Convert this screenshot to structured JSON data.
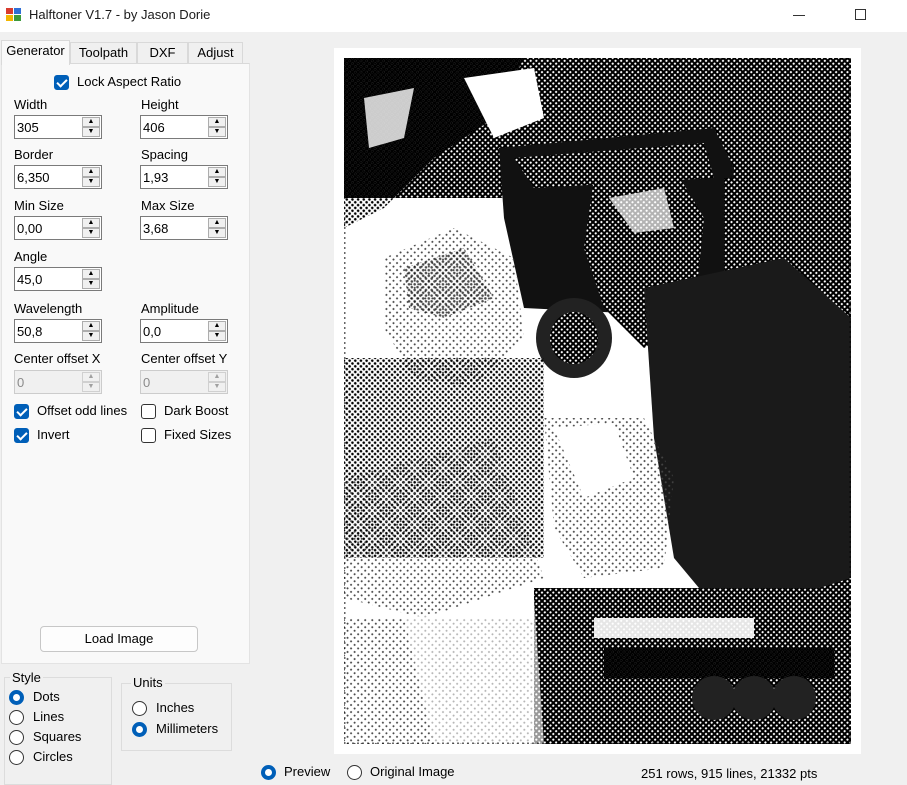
{
  "window": {
    "title": "Halftoner V1.7 - by Jason Dorie"
  },
  "tabs": [
    {
      "label": "Generator",
      "active": true
    },
    {
      "label": "Toolpath",
      "active": false
    },
    {
      "label": "DXF",
      "active": false
    },
    {
      "label": "Adjust",
      "active": false
    }
  ],
  "generator": {
    "lock_aspect": {
      "label": "Lock Aspect Ratio",
      "checked": true
    },
    "width": {
      "label": "Width",
      "value": "305"
    },
    "height": {
      "label": "Height",
      "value": "406"
    },
    "border": {
      "label": "Border",
      "value": "6,350"
    },
    "spacing": {
      "label": "Spacing",
      "value": "1,93"
    },
    "min_size": {
      "label": "Min Size",
      "value": "0,00"
    },
    "max_size": {
      "label": "Max Size",
      "value": "3,68"
    },
    "angle": {
      "label": "Angle",
      "value": "45,0"
    },
    "wavelength": {
      "label": "Wavelength",
      "value": "50,8"
    },
    "amplitude": {
      "label": "Amplitude",
      "value": "0,0"
    },
    "center_x": {
      "label": "Center offset X",
      "value": "0",
      "disabled": true
    },
    "center_y": {
      "label": "Center offset Y",
      "value": "0",
      "disabled": true
    },
    "offset_odd": {
      "label": "Offset odd lines",
      "checked": true
    },
    "dark_boost": {
      "label": "Dark Boost",
      "checked": false
    },
    "invert": {
      "label": "Invert",
      "checked": true
    },
    "fixed_sizes": {
      "label": "Fixed Sizes",
      "checked": false
    },
    "load_button": "Load Image"
  },
  "style_group": {
    "title": "Style",
    "options": [
      {
        "label": "Dots",
        "selected": true
      },
      {
        "label": "Lines",
        "selected": false
      },
      {
        "label": "Squares",
        "selected": false
      },
      {
        "label": "Circles",
        "selected": false
      }
    ]
  },
  "units_group": {
    "title": "Units",
    "options": [
      {
        "label": "Inches",
        "selected": false
      },
      {
        "label": "Millimeters",
        "selected": true
      }
    ]
  },
  "view": {
    "preview": {
      "label": "Preview",
      "selected": true
    },
    "original": {
      "label": "Original Image",
      "selected": false
    }
  },
  "status": "251 rows, 915 lines, 21332 pts",
  "colors": {
    "accent": "#005fb8",
    "panel_bg": "#f9f9f9",
    "window_bg": "#f0f0f0"
  },
  "icons": {
    "app": "halftoner-app-icon",
    "minimize": "minimize-icon",
    "maximize": "maximize-icon"
  }
}
